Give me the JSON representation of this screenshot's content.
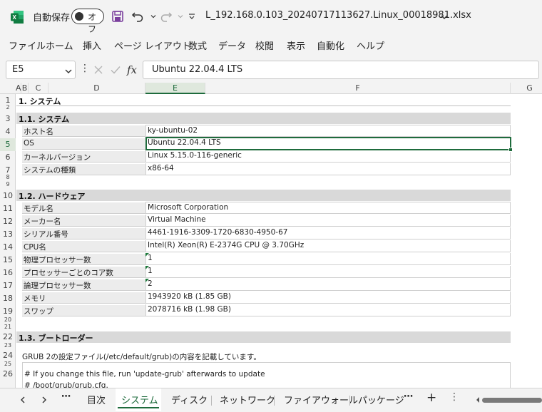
{
  "titlebar": {
    "autosave_label": "自動保存",
    "autosave_state": "オフ",
    "filename": "L_192.168.0.103_20240717113627.Linux_00018981.xlsx"
  },
  "ribbon": {
    "tabs": [
      "ファイル",
      "ホーム",
      "挿入",
      "ページ レイアウト",
      "数式",
      "データ",
      "校閲",
      "表示",
      "自動化",
      "ヘルプ"
    ]
  },
  "formula_bar": {
    "name_box": "E5",
    "dots": "⋮",
    "fx": "fx",
    "value": "Ubuntu 22.04.4 LTS"
  },
  "grid": {
    "columns": [
      "A",
      "B",
      "C",
      "D",
      "E",
      "F",
      "G"
    ],
    "rows": [
      "1",
      "2",
      "3",
      "4",
      "5",
      "6",
      "7",
      "8",
      "9",
      "10",
      "11",
      "12",
      "13",
      "14",
      "15",
      "16",
      "17",
      "18",
      "19",
      "20",
      "21",
      "22",
      "23",
      "24",
      "25",
      "26"
    ],
    "section_title": "1. システム",
    "sub1": {
      "title": "1.1. システム",
      "items": [
        {
          "label": "ホスト名",
          "value": "ky-ubuntu-02"
        },
        {
          "label": "OS",
          "value": "Ubuntu 22.04.4 LTS"
        },
        {
          "label": "カーネルバージョン",
          "value": "Linux 5.15.0-116-generic"
        },
        {
          "label": "システムの種類",
          "value": "x86-64"
        }
      ]
    },
    "sub2": {
      "title": "1.2. ハードウェア",
      "items": [
        {
          "label": "モデル名",
          "value": "Microsoft Corporation"
        },
        {
          "label": "メーカー名",
          "value": "Virtual Machine"
        },
        {
          "label": "シリアル番号",
          "value": "4461-1916-3309-1720-6830-4950-67"
        },
        {
          "label": "CPU名",
          "value": "Intel(R) Xeon(R) E-2374G CPU @ 3.70GHz"
        },
        {
          "label": "物理プロセッサー数",
          "value": "1"
        },
        {
          "label": "プロセッサーごとのコア数",
          "value": "1"
        },
        {
          "label": "論理プロセッサー数",
          "value": "2"
        },
        {
          "label": "メモリ",
          "value": "1943920 kB (1.85 GB)"
        },
        {
          "label": "スワップ",
          "value": "2078716 kB (1.98 GB)"
        }
      ]
    },
    "sub3": {
      "title": "1.3. ブートローダー",
      "description": "GRUB 2の設定ファイル(/etc/default/grub)の内容を記載しています。",
      "code_lines": [
        "# If you change this file, run 'update-grub' afterwards to update",
        "# /boot/grub/grub.cfg."
      ]
    }
  },
  "sheet_tabs": {
    "tabs": [
      "目次",
      "システム",
      "ディスク",
      "ネットワーク",
      "ファイアウォール",
      "パッケージ"
    ],
    "active": "システム",
    "more": "⋯",
    "add": "+"
  },
  "colors": {
    "excel_green": "#1e6b3c",
    "section_gray": "#d9d9d9",
    "label_gray": "#ececec"
  },
  "icons": [
    "excel-logo-icon",
    "save-icon",
    "undo-icon",
    "redo-icon",
    "customize-qat-icon",
    "chevron-down-icon",
    "cancel-icon",
    "enter-icon",
    "fx-icon",
    "prev-sheet-icon",
    "next-sheet-icon",
    "more-sheets-icon",
    "add-sheet-icon"
  ]
}
